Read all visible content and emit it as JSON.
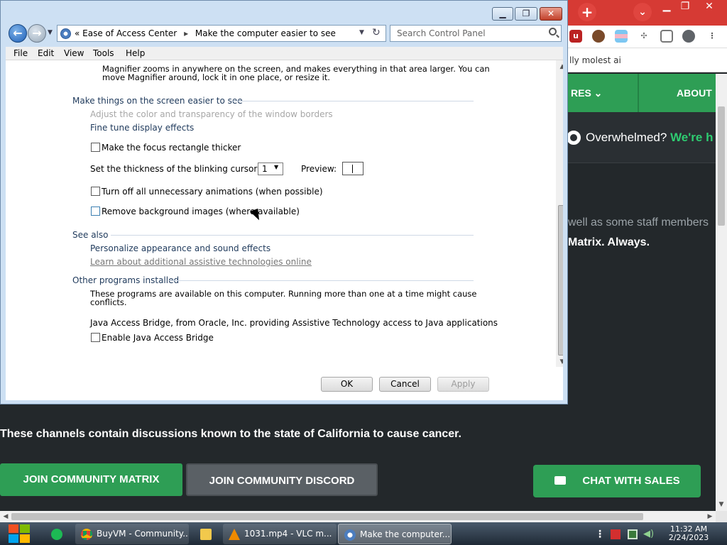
{
  "browser": {
    "bookmark": "lly molest ai",
    "nav": {
      "item1": "RES",
      "item2": "ABOUT"
    },
    "banner": {
      "lead": "Overwhelmed?",
      "highlight": "We're h"
    },
    "body": {
      "staff": "well as some staff members",
      "matrix": "Matrix. Always.",
      "cancer_notice": "These channels contain discussions known to the state of California to cause cancer."
    },
    "buttons": {
      "join_matrix": "JOIN COMMUNITY MATRIX",
      "join_discord": "JOIN COMMUNITY DISCORD",
      "chat_sales": "CHAT WITH SALES"
    },
    "colors": {
      "brand_green": "#2e9e55",
      "titlebar_red": "#d63a34",
      "page_bg": "#23282b"
    }
  },
  "window": {
    "caption": {
      "minimize": "▁",
      "maximize": "❐",
      "close": "✕"
    },
    "address": {
      "prefix": "«",
      "crumb1": "Ease of Access Center",
      "separator": "▸",
      "crumb2": "Make the computer easier to see"
    },
    "search": {
      "placeholder": "Search Control Panel"
    },
    "menu": [
      "File",
      "Edit",
      "View",
      "Tools",
      "Help"
    ],
    "magnifier": {
      "line1": "Magnifier zooms in anywhere on the screen, and makes everything in that area larger. You can",
      "line2": "move Magnifier around, lock it in one place, or resize it."
    },
    "section_easier": {
      "title": "Make things on the screen easier to see",
      "link_transparency": "Adjust the color and transparency of the window borders",
      "link_fine_tune": "Fine tune display effects",
      "focus_rect": "Make the focus rectangle thicker",
      "cursor_label": "Set the thickness of the blinking cursor:",
      "cursor_value": "1",
      "preview_label": "Preview:",
      "animations": "Turn off all unnecessary animations (when possible)",
      "background": "Remove background images (where available)"
    },
    "section_see_also": {
      "title": "See also",
      "personalize": "Personalize appearance and sound effects",
      "learn_more": "Learn about additional assistive technologies online"
    },
    "section_other": {
      "title": "Other programs installed",
      "desc1": "These programs are available on this computer. Running more than one at a time might cause",
      "desc2": "conflicts.",
      "java": "Java Access Bridge, from Oracle, Inc. providing Assistive Technology access to Java applications",
      "java_enable": "Enable Java Access Bridge"
    },
    "buttons": {
      "ok": "OK",
      "cancel": "Cancel",
      "apply": "Apply"
    }
  },
  "taskbar": {
    "items": [
      "BuyVM - Community...",
      "1031.mp4 - VLC m...",
      "Make the computer..."
    ],
    "time": "11:32 AM",
    "date": "2/24/2023"
  }
}
